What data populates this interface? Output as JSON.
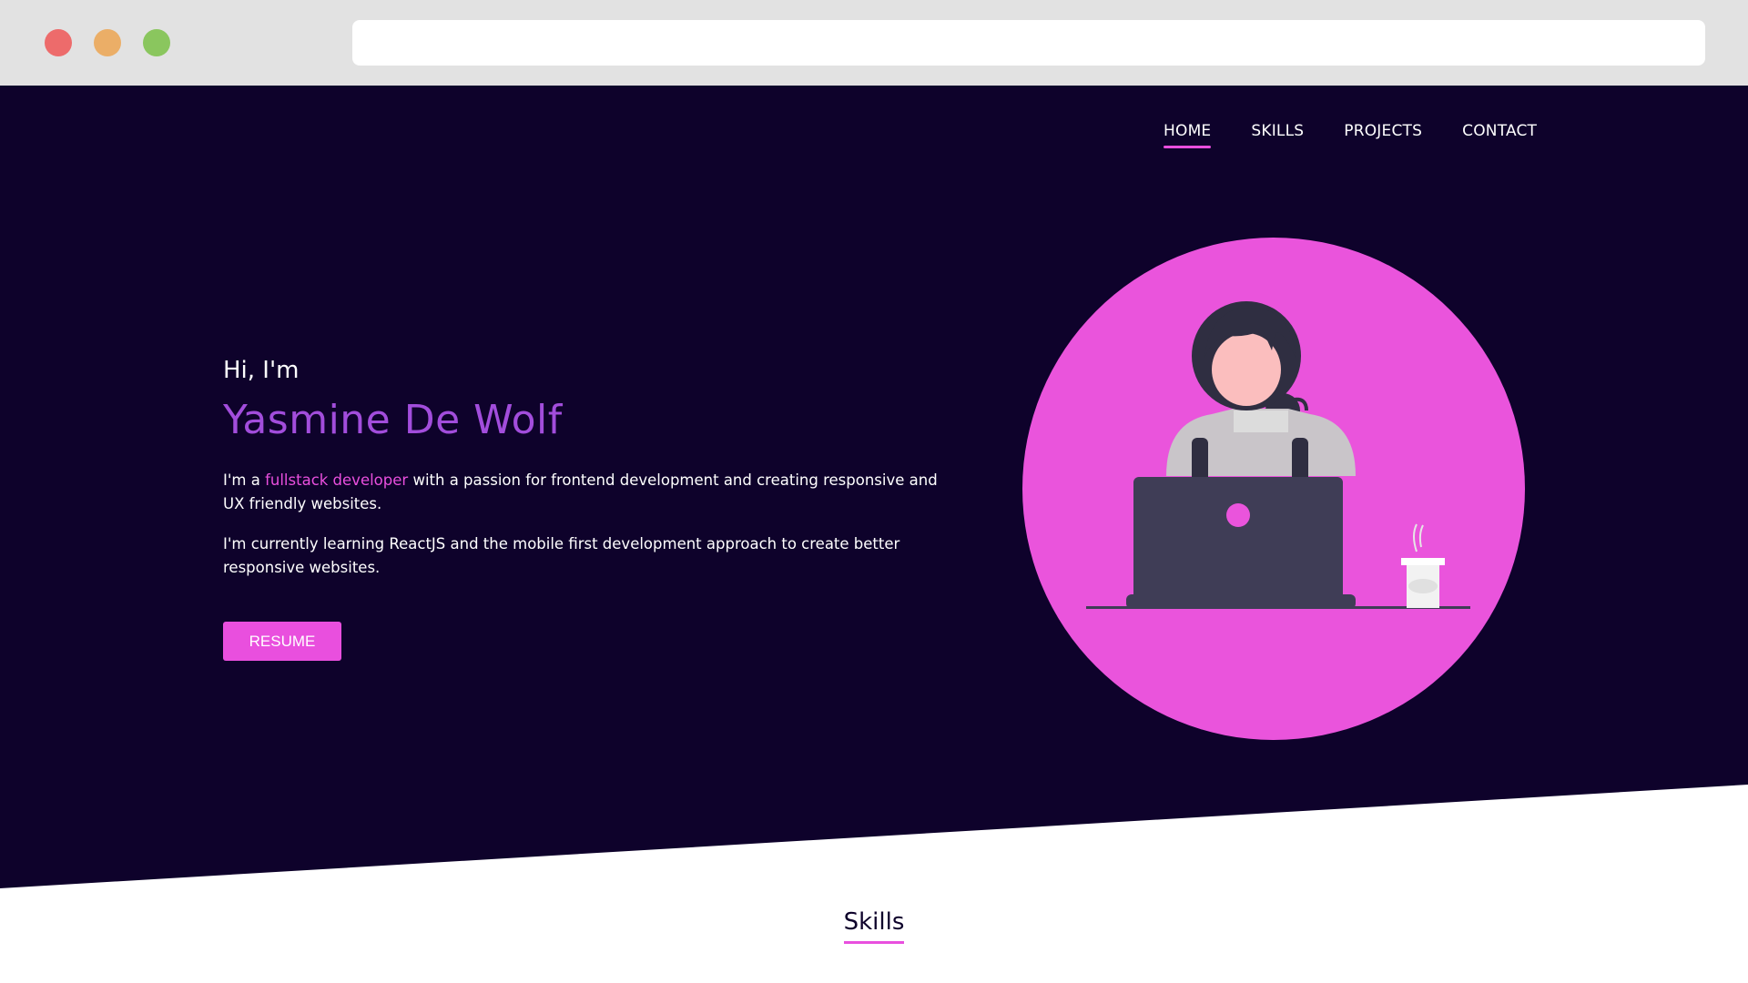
{
  "browser": {
    "url": ""
  },
  "nav": {
    "items": [
      {
        "label": "HOME",
        "active": true
      },
      {
        "label": "SKILLS",
        "active": false
      },
      {
        "label": "PROJECTS",
        "active": false
      },
      {
        "label": "CONTACT",
        "active": false
      }
    ]
  },
  "hero": {
    "greeting": "Hi, I'm",
    "name": "Yasmine De Wolf",
    "intro_prefix": "I'm a ",
    "intro_highlight": "fullstack developer",
    "intro_suffix": " with a passion for frontend development and creating responsive and UX friendly websites.",
    "learning": "I'm currently learning ReactJS and the mobile first development approach to create better responsive websites.",
    "resume_label": "RESUME",
    "illustration_icon": "developer-at-laptop-illustration"
  },
  "skills": {
    "title": "Skills"
  },
  "colors": {
    "background": "#0e022b",
    "accent": "#e94fde",
    "name_color": "#a24ddc",
    "circle": "#ea54dc"
  }
}
